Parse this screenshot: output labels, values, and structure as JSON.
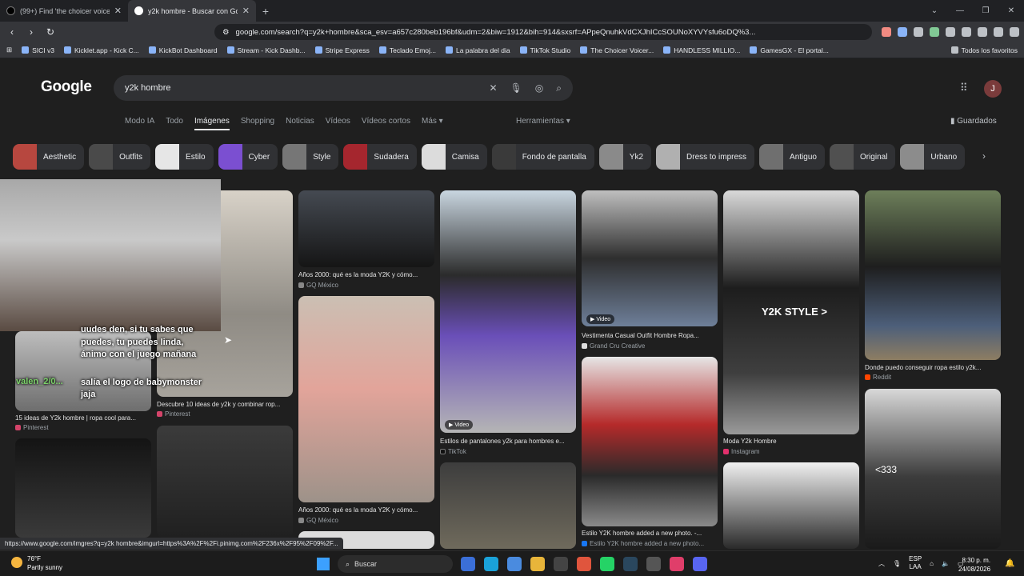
{
  "browser": {
    "tabs": [
      {
        "title": "(99+) Find 'the choicer voicer' on TikTok",
        "active": false
      },
      {
        "title": "y2k hombre - Buscar con Google",
        "active": true
      }
    ],
    "new_tab": "+",
    "url": "google.com/search?q=y2k+hombre&sca_esv=a657c280beb196bf&udm=2&biw=1912&bih=914&sxsrf=APpeQnuhkVdCXJhICcSOUNoXYVYsfu6oDQ%3...",
    "bookmarks": [
      "SICI v3",
      "Kicklet.app - Kick C...",
      "KickBot Dashboard",
      "Stream - Kick Dashb...",
      "Stripe Express",
      "Teclado Emoj...",
      "La palabra del dia",
      "TikTok Studio",
      "The Choicer Voicer...",
      "HANDLESS MILLIO...",
      "GamesGX - El portal..."
    ],
    "all_bookmarks": "Todos los favoritos"
  },
  "google": {
    "logo": "Google",
    "query": "y2k hombre",
    "tabs": [
      "Modo IA",
      "Todo",
      "Imágenes",
      "Shopping",
      "Noticias",
      "Vídeos",
      "Vídeos cortos",
      "Más ▾"
    ],
    "active_tab": "Imágenes",
    "tools": "Herramientas ▾",
    "saved": "Guardados",
    "avatar": "J",
    "chips": [
      "Aesthetic",
      "Outfits",
      "Estilo",
      "Cyber",
      "Style",
      "Sudadera",
      "Camisa",
      "Fondo de pantalla",
      "Yk2",
      "Dress to impress",
      "Antiguo",
      "Original",
      "Urbano"
    ]
  },
  "results": {
    "r1_cap": "Años 2000: qué es la moda Y2K y cómo...",
    "r1_src": "GQ México",
    "r2_cap": "Años 2000: qué es la moda Y2K y cómo...",
    "r2_src": "GQ México",
    "r3_cap": "Estilos de pantalones y2k para hombres e...",
    "r3_src": "TikTok",
    "r4_cap": "Vestimenta Casual Outfit Hombre Ropa...",
    "r4_src": "Grand Cru Creative",
    "r5_cap": "Estilo Y2K hombre added a new photo. -...",
    "r5_src": "Estilo Y2K hombre added a new photo...",
    "r6_cap": "Moda Y2k Hombre",
    "r6_src": "Instagram",
    "r7_cap": "Donde puedo conseguir ropa estilo y2k...",
    "r7_src": "Reddit",
    "r8_cap": "15 ideas de Y2k hombre | ropa cool para...",
    "r8_src": "Pinterest",
    "r9_cap": "Descubre 10 ideas de y2k y combinar rop...",
    "r9_src": "Pinterest",
    "video": "▶ Video",
    "img_label_y2k": "Y2K STYLE >",
    "img_label_333": "<333"
  },
  "overlay": {
    "line1": "uudes den, si tu sabes que",
    "line2": "puedes, tu puedes linda,",
    "line3": "ánimo con el juego mañana",
    "user": "valen_2/0...",
    "line4": "salía el logo de babymonster",
    "line5": "jaja"
  },
  "status_url": "https://www.google.com/imgres?q=y2k hombre&imgurl=https%3A%2F%2Fi.pinimg.com%2F236x%2F95%2F09%2F...",
  "taskbar": {
    "temp": "76°F",
    "weather": "Partly sunny",
    "search": "Buscar",
    "lang1": "ESP",
    "lang2": "LAA",
    "time": "8:30 p. m.",
    "date": "24/08/2026"
  }
}
